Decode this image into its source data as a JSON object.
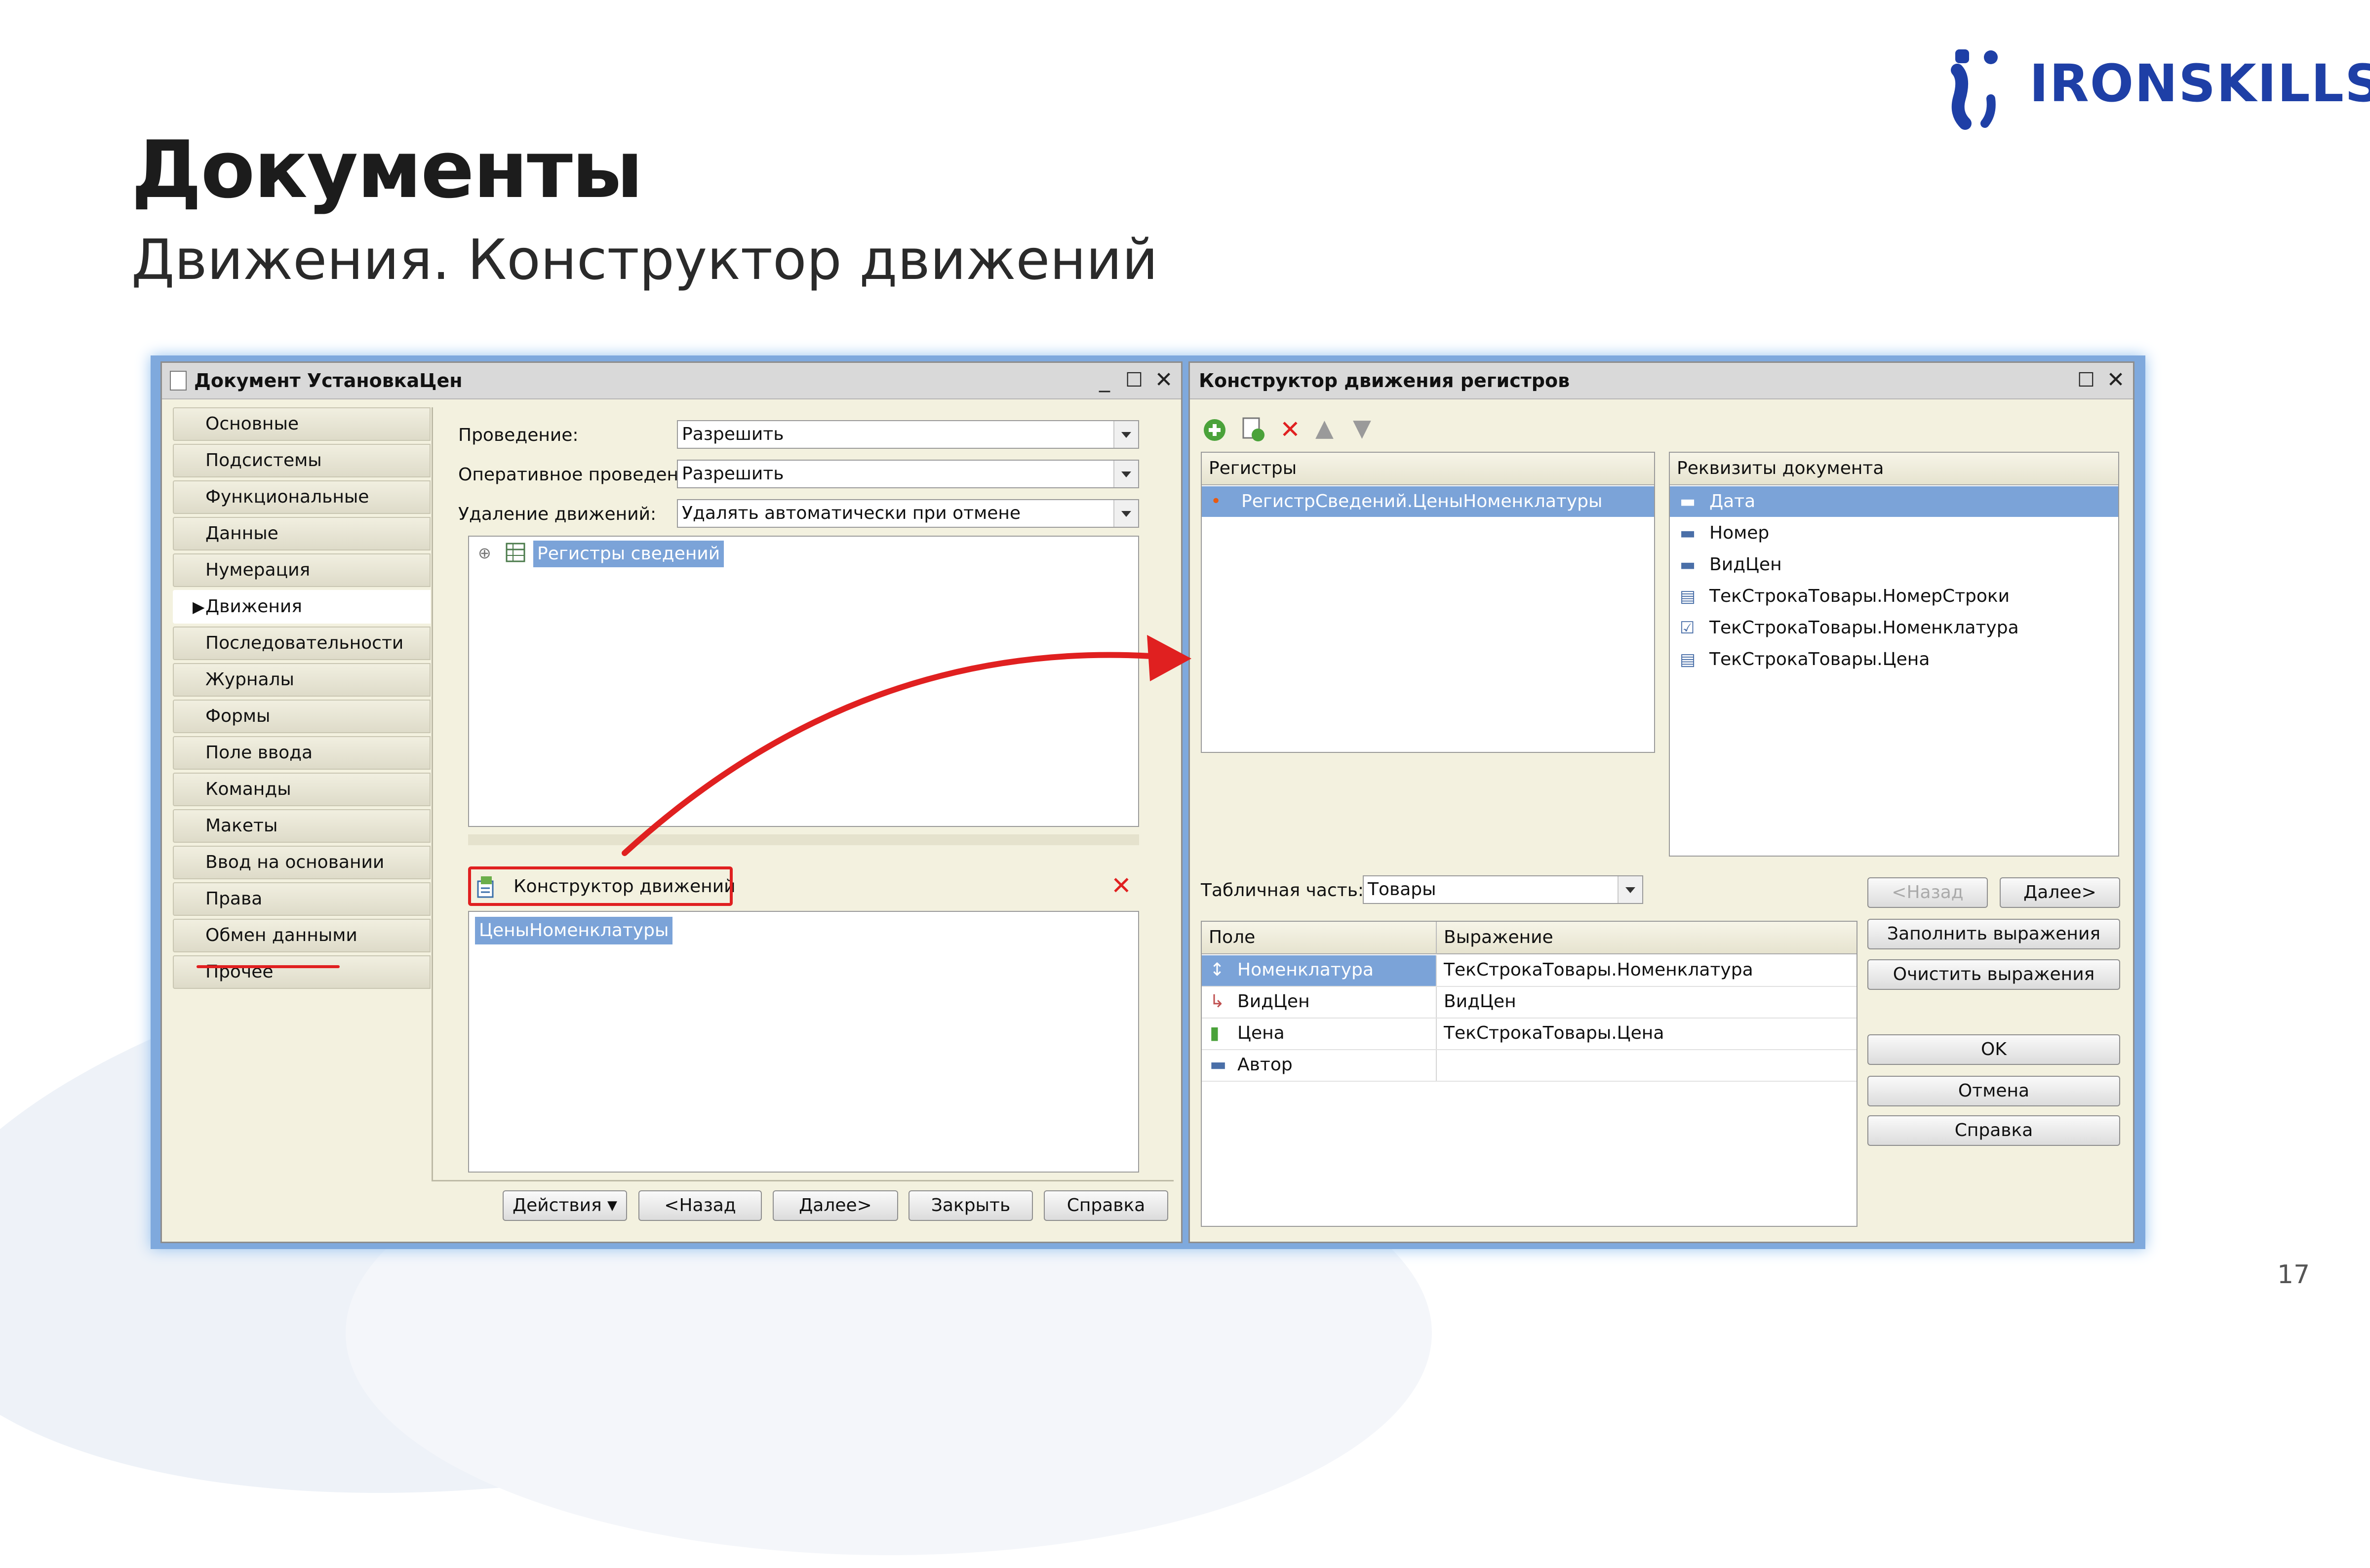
{
  "slide": {
    "title": "Документы",
    "subtitle": "Движения. Конструктор движений",
    "logo_text": "IRONSKILLS",
    "page_number": "17"
  },
  "doc_window": {
    "title": "Документ УстановкаЦен",
    "nav_items": [
      "Основные",
      "Подсистемы",
      "Функциональные опции",
      "Данные",
      "Нумерация",
      "Движения",
      "Последовательности",
      "Журналы",
      "Формы",
      "Поле ввода",
      "Команды",
      "Макеты",
      "Ввод на основании",
      "Права",
      "Обмен данными",
      "Прочее"
    ],
    "active_nav": "Движения",
    "fields": {
      "posting_label": "Проведение:",
      "posting_value": "Разрешить",
      "realtime_label": "Оперативное проведение:",
      "realtime_value": "Разрешить",
      "delete_label": "Удаление движений:",
      "delete_value": "Удалять автоматически при отмене проведения"
    },
    "tree_item": "Регистры сведений",
    "constructor_button": "Конструктор движений",
    "movements_item": "ЦеныНоменклатуры",
    "buttons": [
      "Действия",
      "<Назад",
      "Далее>",
      "Закрыть",
      "Справка"
    ]
  },
  "constructor_window": {
    "title": "Конструктор движения регистров",
    "registers_header": "Регистры",
    "registers": [
      "РегистрСведений.ЦеныНоменклатуры"
    ],
    "requisites_header": "Реквизиты документа",
    "requisites": [
      "Дата",
      "Номер",
      "ВидЦен",
      "ТекСтрокаТовары.НомерСтроки",
      "ТекСтрокаТовары.Номенклатура",
      "ТекСтрокаТовары.Цена"
    ],
    "tabular_label": "Табличная часть:",
    "tabular_value": "Товары",
    "grid_headers": [
      "Поле",
      "Выражение"
    ],
    "grid_rows": [
      {
        "field": "Номенклатура",
        "expr": "ТекСтрокаТовары.Номенклатура"
      },
      {
        "field": "ВидЦен",
        "expr": "ВидЦен"
      },
      {
        "field": "Цена",
        "expr": "ТекСтрокаТовары.Цена"
      },
      {
        "field": "Автор",
        "expr": ""
      }
    ],
    "buttons": {
      "back": "<Назад",
      "next": "Далее>",
      "fill": "Заполнить выражения",
      "clear": "Очистить выражения",
      "ok": "OK",
      "cancel": "Отмена",
      "help": "Справка"
    }
  },
  "colors": {
    "accent_red": "#e02020",
    "selection": "#7ba3d8",
    "logo_blue": "#1e3fa6"
  }
}
